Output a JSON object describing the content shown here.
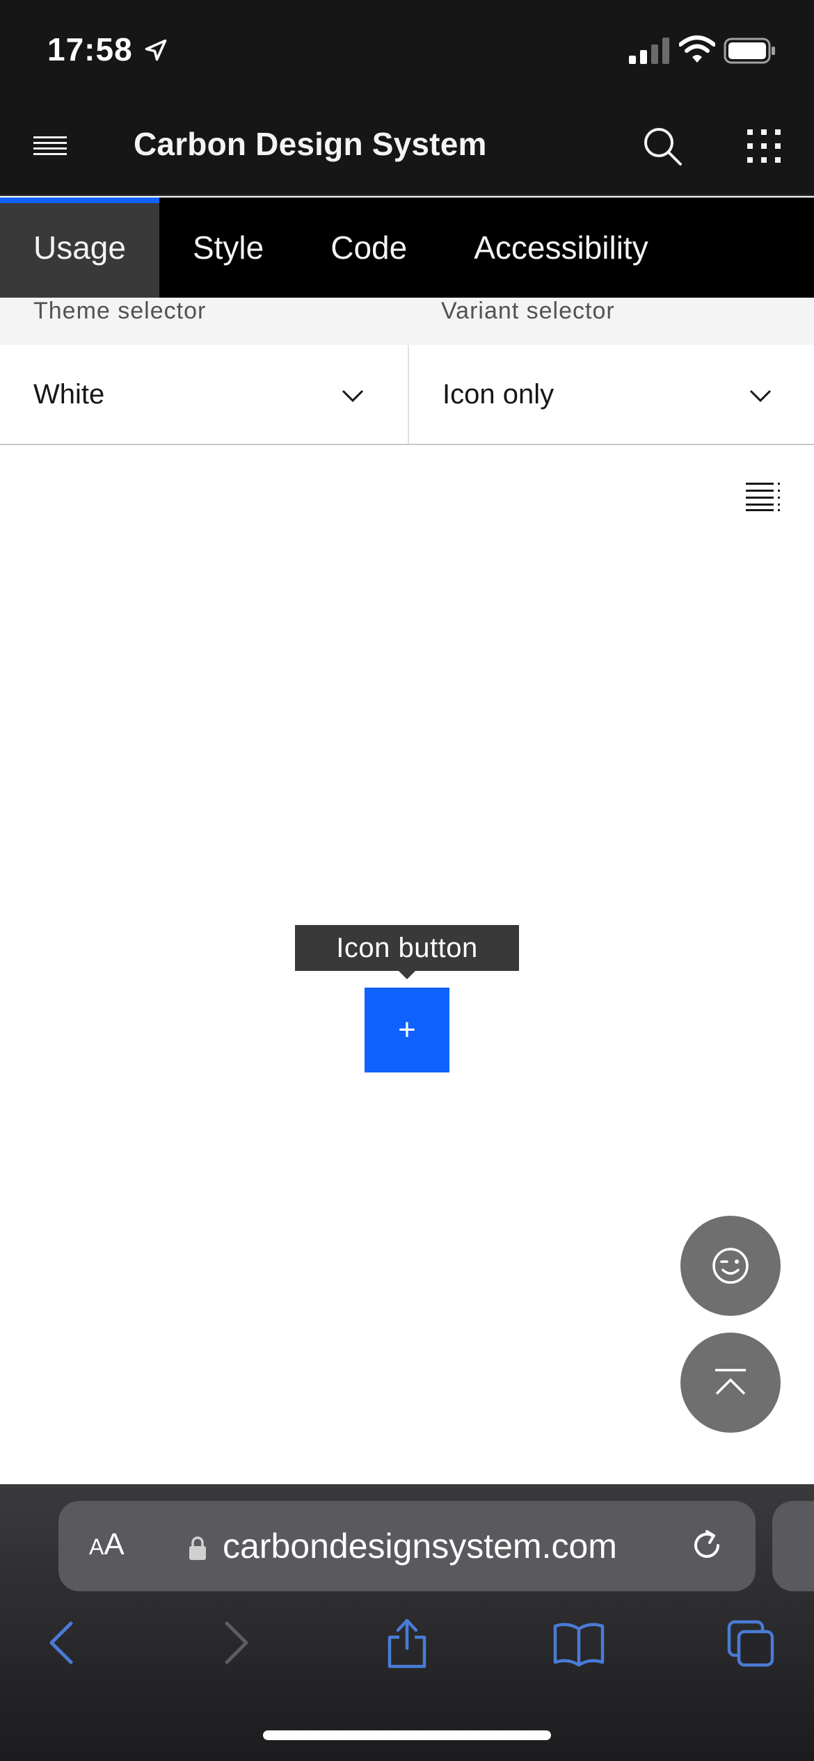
{
  "status_bar": {
    "time": "17:58"
  },
  "header": {
    "title": "Carbon Design System"
  },
  "tabs": [
    {
      "label": "Usage",
      "active": true
    },
    {
      "label": "Style"
    },
    {
      "label": "Code"
    },
    {
      "label": "Accessibility"
    }
  ],
  "selectors": {
    "theme": {
      "label": "Theme selector",
      "value": "White"
    },
    "variant": {
      "label": "Variant selector",
      "value": "Icon only"
    }
  },
  "demo": {
    "tooltip": "Icon button",
    "button_glyph": "+"
  },
  "browser": {
    "aa_label_small": "A",
    "aa_label_large": "A",
    "url": "carbondesignsystem.com"
  },
  "colors": {
    "brand_blue": "#0f62fe",
    "header_bg": "#161616",
    "tab_active_bg": "#393939",
    "fab_bg": "#6f6f6f",
    "safari_blue": "#4a7bd6"
  },
  "icons": {
    "menu": "hamburger-icon",
    "search": "search-icon",
    "switcher": "app-switcher-icon",
    "list": "list-icon",
    "feedback": "wink-face-icon",
    "back_to_top": "back-to-top-icon"
  }
}
